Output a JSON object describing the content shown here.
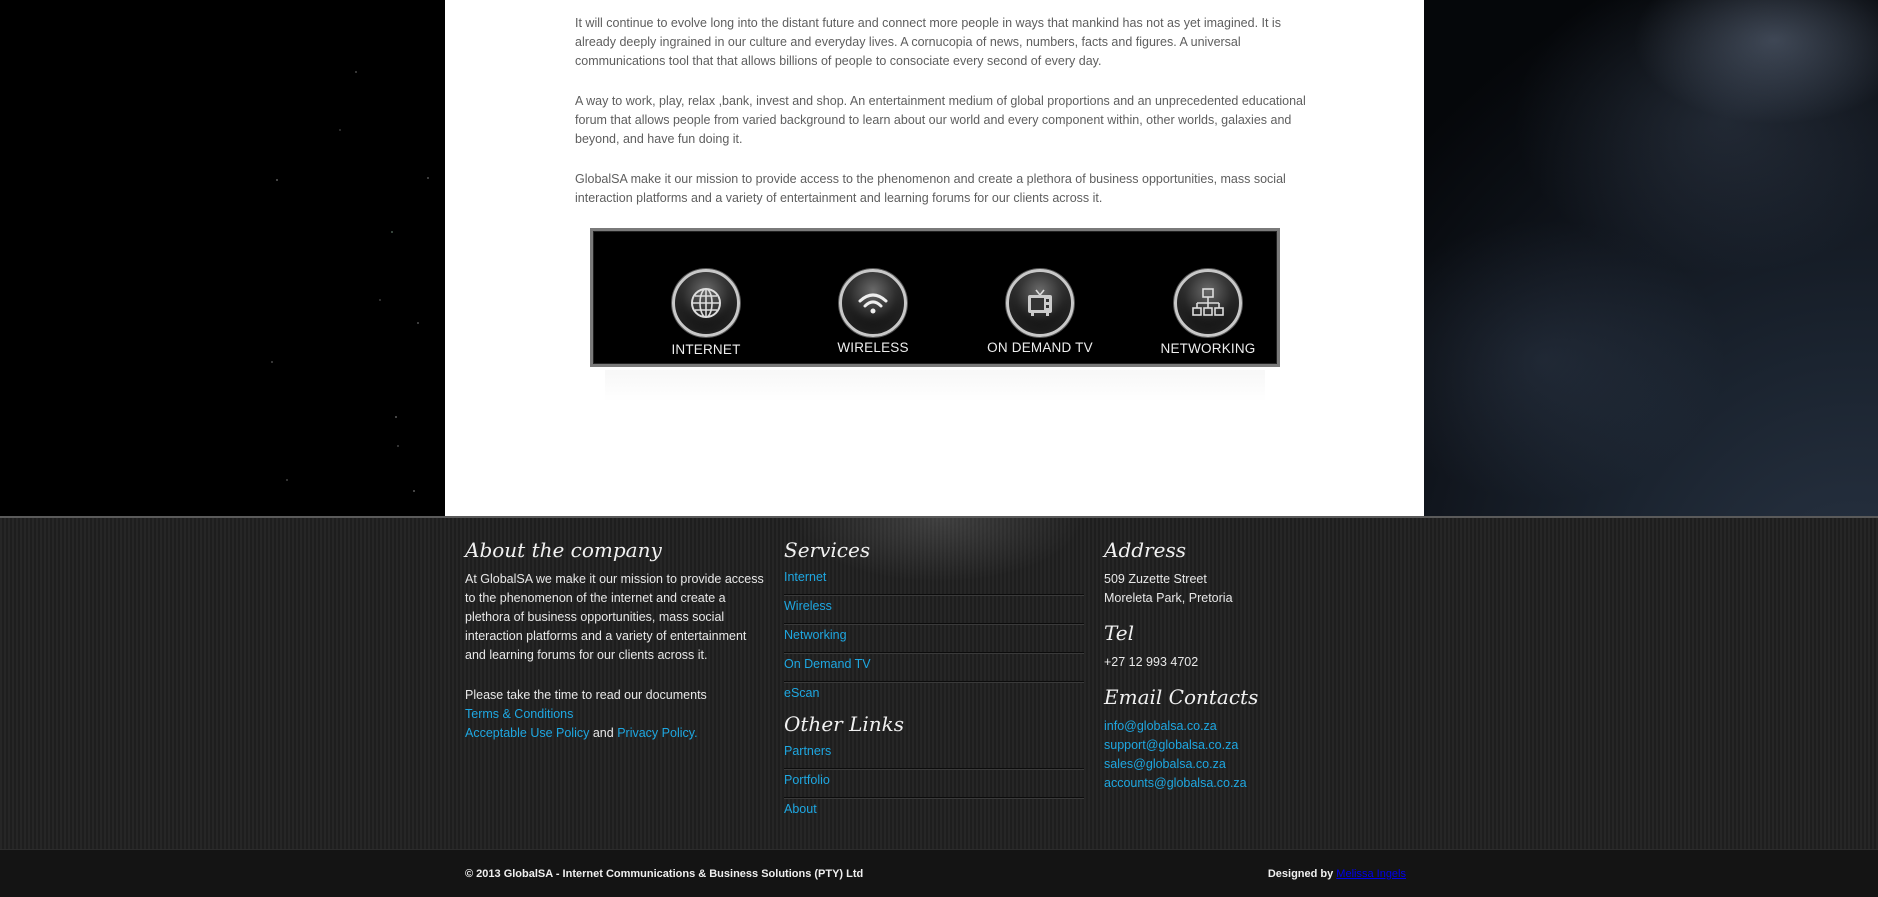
{
  "content": {
    "paragraphs": [
      "It will continue to evolve long into the distant future and connect more people in ways that mankind has not as yet imagined. It is already deeply ingrained in our culture and everyday lives. A cornucopia of news, numbers, facts and figures. A universal communications tool that that allows billions of people to consociate every second of every day.",
      "A way to work, play, relax ,bank, invest and shop. An entertainment medium of global proportions and an unprecedented educational forum that allows people from varied background to learn about our world and every component within, other worlds, galaxies and beyond, and have fun doing it.",
      "GlobalSA make it our mission to provide access to the phenomenon and create a plethora of business opportunities, mass social interaction platforms and a variety of entertainment and learning forums for our clients across it."
    ]
  },
  "services_banner": [
    {
      "label": "INTERNET",
      "icon": "globe-icon"
    },
    {
      "label": "WIRELESS",
      "icon": "wifi-icon"
    },
    {
      "label": "ON DEMAND TV",
      "icon": "tv-icon"
    },
    {
      "label": "NETWORKING",
      "icon": "network-icon"
    }
  ],
  "footer": {
    "about": {
      "heading": "About the company",
      "text": "At GlobalSA we make it our mission to provide access to the phenomenon of the internet and create a plethora of business opportunities, mass social interaction platforms and a variety of entertainment and learning forums for our clients across it.",
      "docs_intro": "Please take the time to read our documents",
      "terms": "Terms & Conditions",
      "aup": "Acceptable Use Policy",
      "and": "and",
      "privacy": "Privacy Policy."
    },
    "services": {
      "heading": "Services",
      "items": [
        "Internet",
        "Wireless",
        "Networking",
        "On Demand TV",
        "eScan"
      ]
    },
    "other_links": {
      "heading": "Other Links",
      "items": [
        "Partners",
        "Portfolio",
        "About"
      ]
    },
    "address": {
      "heading": "Address",
      "line1": "509 Zuzette Street",
      "line2": "Moreleta Park, Pretoria"
    },
    "tel": {
      "heading": "Tel",
      "number": "+27 12 993 4702"
    },
    "email": {
      "heading": "Email Contacts",
      "items": [
        "info@globalsa.co.za",
        "support@globalsa.co.za",
        "sales@globalsa.co.za",
        "accounts@globalsa.co.za"
      ]
    },
    "bottom": {
      "copyright": "© 2013 GlobalSA - Internet Communications & Business Solutions (PTY) Ltd",
      "designed_by": "Designed by",
      "designer": "Melissa Ingels"
    }
  },
  "colors": {
    "link": "#1ea7e1",
    "footer_bg": "#222222",
    "panel_bg": "#ffffff"
  }
}
